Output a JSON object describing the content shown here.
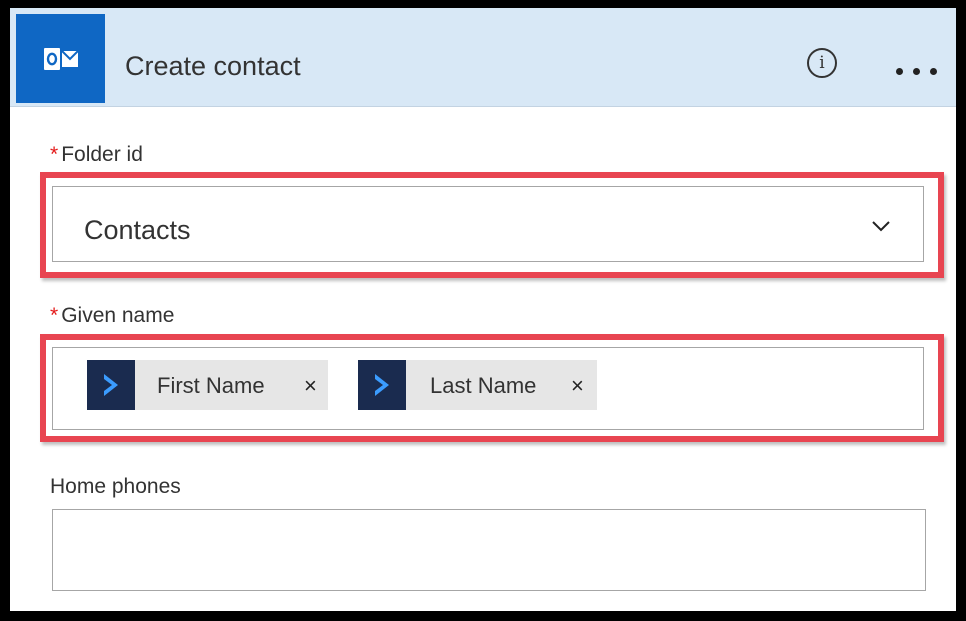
{
  "header": {
    "app_icon": "outlook-icon",
    "title": "Create contact",
    "info_icon": "info-icon",
    "info_glyph": "i",
    "more_icon": "more-options-icon"
  },
  "fields": {
    "folder_id": {
      "required_mark": "*",
      "label": "Folder id",
      "value": "Contacts",
      "dropdown_icon": "chevron-down-icon"
    },
    "given_name": {
      "required_mark": "*",
      "label": "Given name",
      "tokens": [
        {
          "label": "First Name",
          "remove": "×",
          "icon": "dynamics-icon"
        },
        {
          "label": "Last Name",
          "remove": "×",
          "icon": "dynamics-icon"
        }
      ]
    },
    "home_phones": {
      "label": "Home phones",
      "value": ""
    }
  },
  "colors": {
    "header_bg": "#d8e8f6",
    "outlook_blue": "#0f67c4",
    "dynamics_navy": "#1a2b4f",
    "highlight_red": "#e84551",
    "required_red": "#e41b1b"
  }
}
